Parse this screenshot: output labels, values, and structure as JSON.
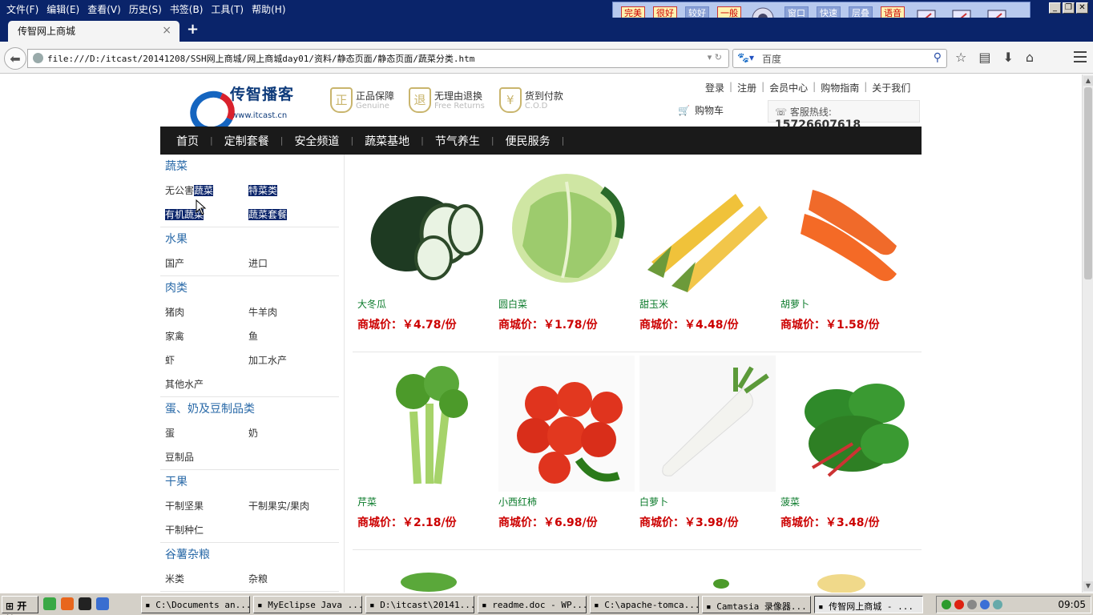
{
  "browser": {
    "menus": [
      "文件(F)",
      "编辑(E)",
      "查看(V)",
      "历史(S)",
      "书签(B)",
      "工具(T)",
      "帮助(H)"
    ],
    "tab_title": "传智网上商城",
    "url": "file:///D:/itcast/20141208/SSH网上商城/网上商城day01/资料/静态页面/静态页面/蔬菜分类.htm",
    "search_placeholder": "百度",
    "ext_buttons": [
      {
        "label": "完美画质",
        "style": "red"
      },
      {
        "label": "很好画质",
        "style": "red"
      },
      {
        "label": "较好画质",
        "style": "grey"
      },
      {
        "label": "一般画质",
        "style": "red"
      },
      {
        "label": "窗口模式",
        "style": "grey"
      },
      {
        "label": "快速高效",
        "style": "grey"
      },
      {
        "label": "层叠窗口",
        "style": "grey"
      },
      {
        "label": "语音广播",
        "style": "red"
      }
    ]
  },
  "header": {
    "logo_name": "传智播客",
    "logo_url": "www.itcast.cn",
    "badges": [
      {
        "icon": "正",
        "title": "正品保障",
        "en": "Genuine"
      },
      {
        "icon": "退",
        "title": "无理由退换",
        "en": "Free Returns"
      },
      {
        "icon": "¥",
        "title": "货到付款",
        "en": "C.O.D"
      }
    ],
    "links": [
      "登录",
      "注册",
      "会员中心",
      "购物指南",
      "关于我们"
    ],
    "cart_label": "购物车",
    "hotline_label": "客服热线:",
    "hotline_number": "15726607618"
  },
  "nav": [
    "首页",
    "定制套餐",
    "安全频道",
    "蔬菜基地",
    "节气养生",
    "便民服务"
  ],
  "sidebar": [
    {
      "title": "蔬菜",
      "items": [
        {
          "label": "无公害蔬菜",
          "sel": "蔬菜"
        },
        {
          "label": "特菜类",
          "sel": "all"
        },
        {
          "label": "有机蔬菜",
          "sel": "all"
        },
        {
          "label": "蔬菜套餐",
          "sel": "all"
        }
      ]
    },
    {
      "title": "水果",
      "items": [
        {
          "label": "国产"
        },
        {
          "label": "进口"
        }
      ]
    },
    {
      "title": "肉类",
      "items": [
        {
          "label": "猪肉"
        },
        {
          "label": "牛羊肉"
        },
        {
          "label": "家禽"
        },
        {
          "label": "鱼"
        },
        {
          "label": "虾"
        },
        {
          "label": "加工水产"
        },
        {
          "label": "其他水产"
        }
      ]
    },
    {
      "title": "蛋、奶及豆制品类",
      "items": [
        {
          "label": "蛋"
        },
        {
          "label": "奶"
        },
        {
          "label": "豆制品"
        }
      ]
    },
    {
      "title": "干果",
      "items": [
        {
          "label": "干制坚果"
        },
        {
          "label": "干制果实/果肉"
        },
        {
          "label": "干制种仁"
        }
      ]
    },
    {
      "title": "谷薯杂粮",
      "items": [
        {
          "label": "米类"
        },
        {
          "label": "杂粮"
        }
      ]
    }
  ],
  "products": [
    {
      "name": "大冬瓜",
      "price_label": "商城价：",
      "price": "￥4.78/份",
      "img": "wax-gourd"
    },
    {
      "name": "圆白菜",
      "price_label": "商城价：",
      "price": "￥1.78/份",
      "img": "cabbage"
    },
    {
      "name": "甜玉米",
      "price_label": "商城价：",
      "price": "￥4.48/份",
      "img": "corn"
    },
    {
      "name": "胡萝卜",
      "price_label": "商城价：",
      "price": "￥1.58/份",
      "img": "carrot"
    },
    {
      "name": "芹菜",
      "price_label": "商城价：",
      "price": "￥2.18/份",
      "img": "celery"
    },
    {
      "name": "小西红柿",
      "price_label": "商城价：",
      "price": "￥6.98/份",
      "img": "tomato"
    },
    {
      "name": "白萝卜",
      "price_label": "商城价：",
      "price": "￥3.98/份",
      "img": "radish"
    },
    {
      "name": "菠菜",
      "price_label": "商城价：",
      "price": "￥3.48/份",
      "img": "spinach"
    }
  ],
  "taskbar": {
    "start": "开始",
    "tasks": [
      "C:\\Documents an...",
      "MyEclipse Java ...",
      "D:\\itcast\\20141...",
      "readme.doc - WP...",
      "C:\\apache-tomca...",
      "Camtasia 录像器...",
      "传智网上商城 - ..."
    ],
    "active_index": 6,
    "clock": "09:05"
  }
}
